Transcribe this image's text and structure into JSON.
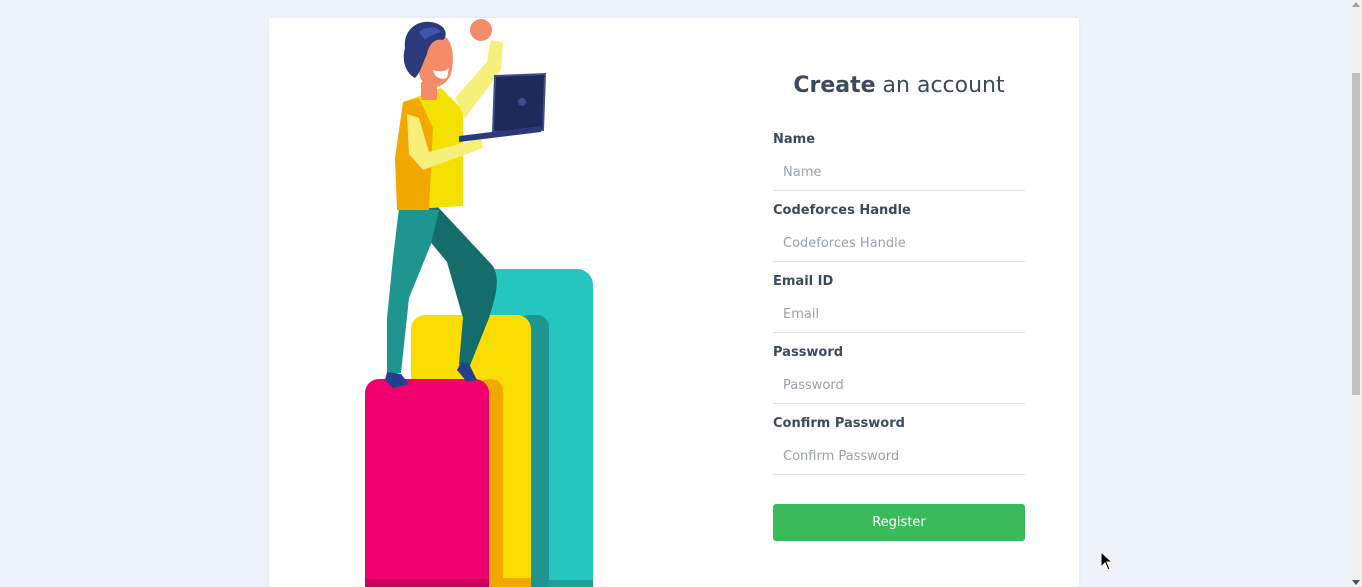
{
  "form": {
    "title_strong": "Create",
    "title_rest": " an account",
    "fields": [
      {
        "label": "Name",
        "placeholder": "Name"
      },
      {
        "label": "Codeforces Handle",
        "placeholder": "Codeforces Handle"
      },
      {
        "label": "Email ID",
        "placeholder": "Email"
      },
      {
        "label": "Password",
        "placeholder": "Password"
      },
      {
        "label": "Confirm Password",
        "placeholder": "Confirm Password"
      }
    ],
    "submit_label": "Register"
  },
  "colors": {
    "background": "#eef3fb",
    "button": "#3bba5c",
    "text": "#3e4a5c",
    "bar_pink": "#f0006f",
    "bar_yellow": "#f9dc00",
    "bar_teal": "#26c6c0"
  },
  "illustration": {
    "subject": "person-with-laptop-on-bar-chart"
  }
}
